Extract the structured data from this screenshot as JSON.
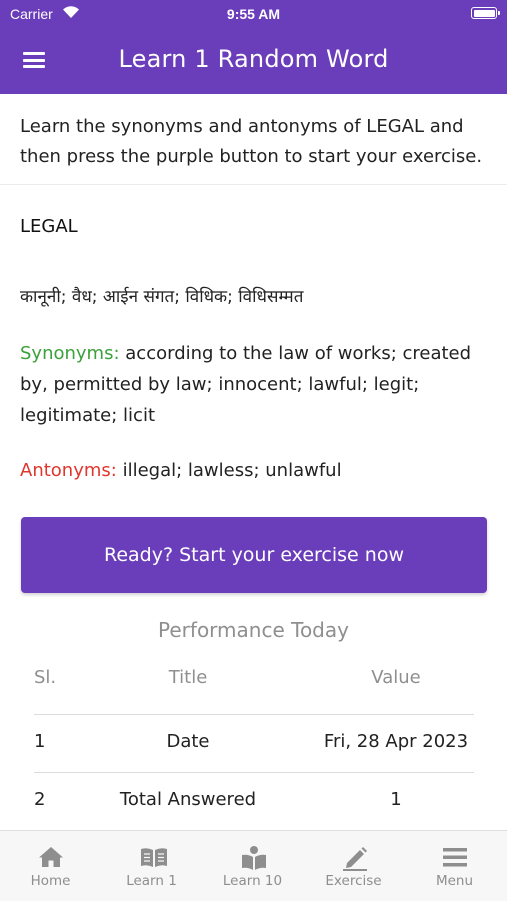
{
  "status_bar": {
    "carrier": "Carrier",
    "time": "9:55 AM"
  },
  "header": {
    "title": "Learn 1 Random Word"
  },
  "instruction": "Learn the synonyms and antonyms of LEGAL and then press the purple button to start your exercise.",
  "word": {
    "title": "LEGAL",
    "translation": "कानूनी; वैध; आईन संगत; विधिक; विधिसम्मत",
    "synonyms_label": "Synonyms:",
    "synonyms": " according to the law of works; created by, permitted by law; innocent; lawful; legit; legitimate; licit",
    "antonyms_label": "Antonyms:",
    "antonyms": " illegal; lawless; unlawful"
  },
  "start_button_label": "Ready? Start your exercise now",
  "performance": {
    "title": "Performance Today",
    "headers": [
      "Sl.",
      "Title",
      "Value"
    ],
    "rows": [
      [
        "1",
        "Date",
        "Fri, 28 Apr 2023"
      ],
      [
        "2",
        "Total Answered",
        "1"
      ]
    ]
  },
  "tabs": [
    {
      "label": "Home",
      "icon": "home-icon"
    },
    {
      "label": "Learn 1",
      "icon": "open-book-icon"
    },
    {
      "label": "Learn 10",
      "icon": "reader-icon"
    },
    {
      "label": "Exercise",
      "icon": "pencil-icon"
    },
    {
      "label": "Menu",
      "icon": "menu-icon"
    }
  ],
  "colors": {
    "primary": "#6a3dba",
    "synonyms": "#3aa23a",
    "antonyms": "#e0362c",
    "muted": "#8f8f8f"
  }
}
